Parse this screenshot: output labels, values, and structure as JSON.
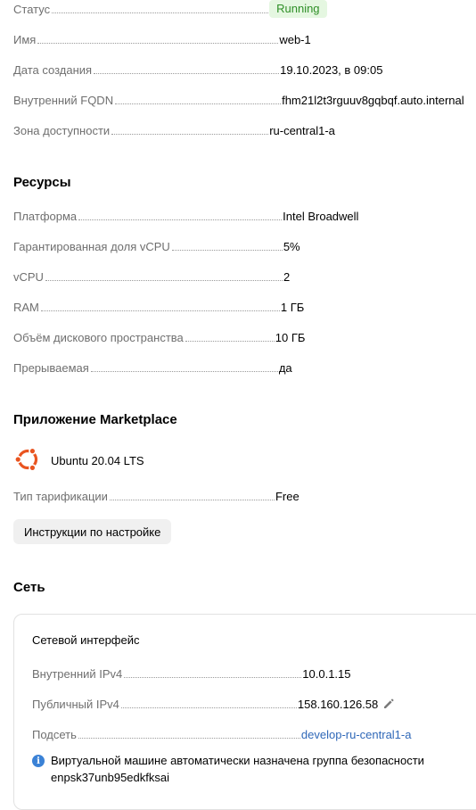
{
  "general": {
    "status": {
      "label": "Статус",
      "value": "Running"
    },
    "name": {
      "label": "Имя",
      "value": "web-1"
    },
    "created": {
      "label": "Дата создания",
      "value": "19.10.2023, в 09:05"
    },
    "fqdn": {
      "label": "Внутренний FQDN",
      "value": "fhm21l2t3rguuv8gqbqf.auto.internal"
    },
    "zone": {
      "label": "Зона доступности",
      "value": "ru-central1-a"
    }
  },
  "resources": {
    "title": "Ресурсы",
    "platform": {
      "label": "Платформа",
      "value": "Intel Broadwell"
    },
    "core_fraction": {
      "label": "Гарантированная доля vCPU",
      "value": "5%"
    },
    "vcpu": {
      "label": "vCPU",
      "value": "2"
    },
    "ram": {
      "label": "RAM",
      "value": "1 ГБ"
    },
    "disk": {
      "label": "Объём дискового пространства",
      "value": "10 ГБ"
    },
    "preemptible": {
      "label": "Прерываемая",
      "value": "да"
    }
  },
  "marketplace": {
    "title": "Приложение Marketplace",
    "app_name": "Ubuntu 20.04 LTS",
    "app_icon": "ubuntu-logo",
    "billing": {
      "label": "Тип тарификации",
      "value": "Free"
    },
    "instructions_button": "Инструкции по настройке"
  },
  "network": {
    "title": "Сеть",
    "card_title": "Сетевой интерфейс",
    "internal_ip": {
      "label": "Внутренний IPv4",
      "value": "10.0.1.15"
    },
    "public_ip": {
      "label": "Публичный IPv4",
      "value": "158.160.126.58"
    },
    "subnet": {
      "label": "Подсеть",
      "value": "develop-ru-central1-a"
    },
    "info_line1": "Виртуальной машине автоматически назначена группа безопасности",
    "info_line2": "enpsk37unb95edkfksai"
  },
  "colors": {
    "status_bg": "#e5f7e1",
    "status_fg": "#2f8f27",
    "link": "#2f68b8",
    "ubuntu_orange": "#e95420",
    "info_blue": "#3b82d6"
  }
}
